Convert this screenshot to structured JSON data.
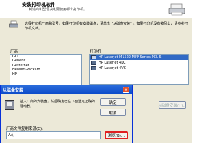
{
  "wizard": {
    "title": "安装打印机软件",
    "description": "制造商和型号决定要使用哪个打印机。",
    "instruction": "选择打印机厂商和型号。如果打印机有安装磁盘，请单击 “从磁盘安装” 。如果打印机没有被列出，请参考打印机文档。",
    "manufacturer_label": "厂商",
    "printer_label": "打印机",
    "manufacturers": [
      "GCC",
      "Generic",
      "Gestetner",
      "Hewlett-Packard",
      "HP"
    ],
    "printers": [
      {
        "name": "HP LaserJet M1522 MFP Series PCL 6",
        "selected": true
      },
      {
        "name": "HP LaserJet 4LC",
        "selected": false
      },
      {
        "name": "HP LaserJet 4VC",
        "selected": false
      }
    ],
    "have_disk_label": "从磁盘安装(H)..."
  },
  "dialog": {
    "title": "从磁盘安装",
    "close": "x",
    "message": "插入厂商的安装盘，然后确定已在下面选定正确的驱动器。",
    "ok_label": "确定",
    "cancel_label": "取消",
    "copy_label": "厂商文件复制来源(C):",
    "copy_value": "A:\\",
    "browse_label": "浏览(B)..."
  }
}
